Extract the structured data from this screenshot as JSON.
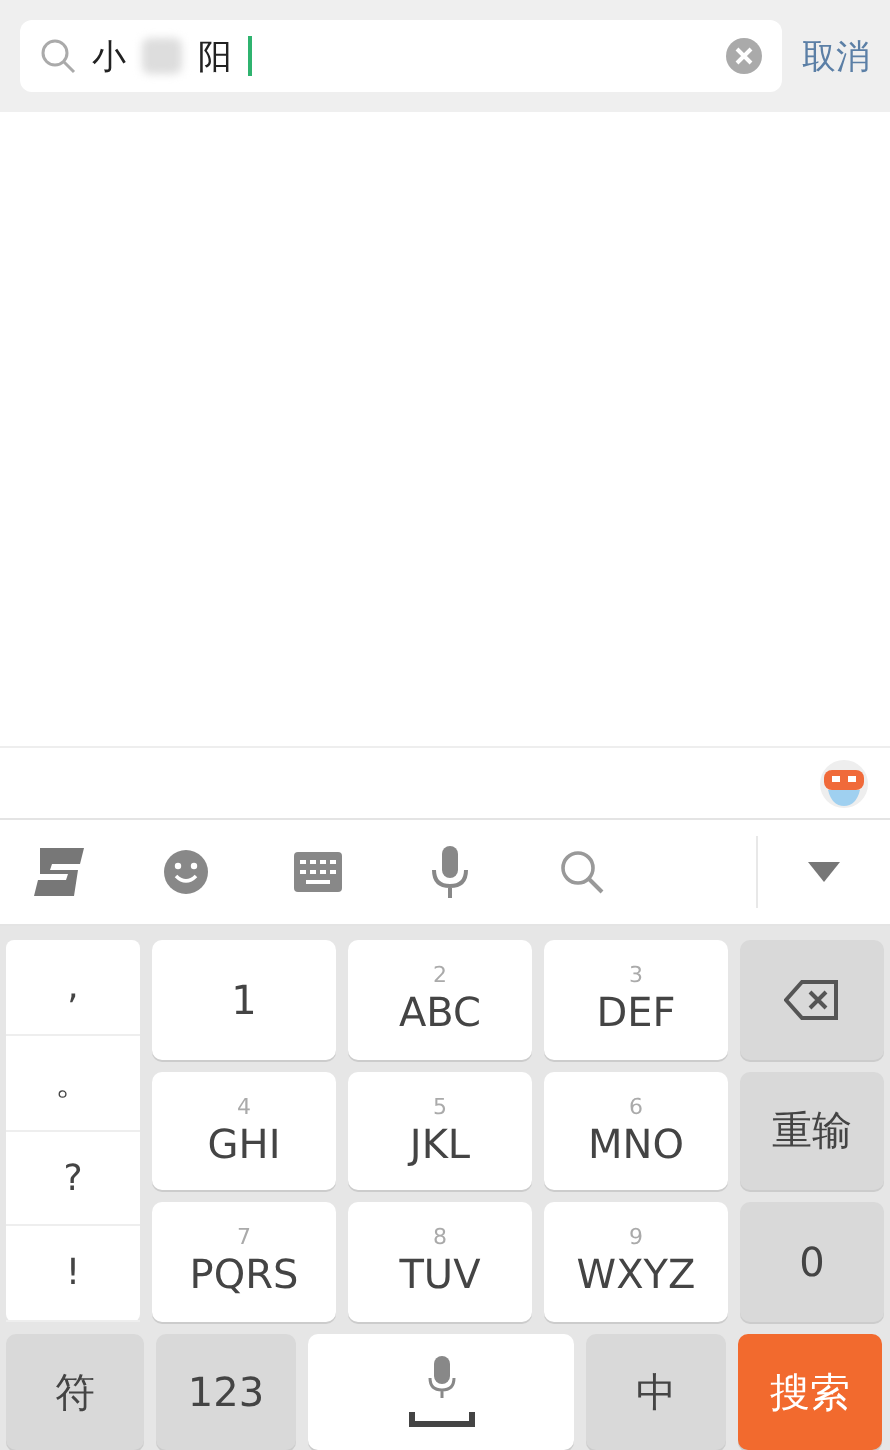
{
  "search": {
    "query_parts": [
      "小",
      "阳"
    ],
    "cancel": "取消"
  },
  "toolbar": {
    "items": [
      {
        "kind": "logo"
      },
      {
        "kind": "emoji"
      },
      {
        "kind": "keyboard"
      },
      {
        "kind": "mic"
      },
      {
        "kind": "search"
      }
    ]
  },
  "keyboard": {
    "punctuation": [
      ",",
      "。",
      "?",
      "!"
    ],
    "keys": [
      {
        "label": "1",
        "kind": "letter"
      },
      {
        "digit": "2",
        "label": "ABC",
        "kind": "letter"
      },
      {
        "digit": "3",
        "label": "DEF",
        "kind": "letter"
      },
      {
        "kind": "backspace"
      },
      {
        "digit": "4",
        "label": "GHI",
        "kind": "letter"
      },
      {
        "digit": "5",
        "label": "JKL",
        "kind": "letter"
      },
      {
        "digit": "6",
        "label": "MNO",
        "kind": "letter"
      },
      {
        "label": "重输",
        "kind": "function"
      },
      {
        "digit": "7",
        "label": "PQRS",
        "kind": "letter"
      },
      {
        "digit": "8",
        "label": "TUV",
        "kind": "letter"
      },
      {
        "digit": "9",
        "label": "WXYZ",
        "kind": "letter"
      },
      {
        "label": "0",
        "kind": "function"
      }
    ],
    "bottom": [
      {
        "label": "符",
        "kind": "function"
      },
      {
        "label": "123",
        "kind": "function"
      },
      {
        "kind": "space"
      },
      {
        "label": "中",
        "kind": "function"
      },
      {
        "label": "搜索",
        "kind": "search"
      }
    ]
  }
}
